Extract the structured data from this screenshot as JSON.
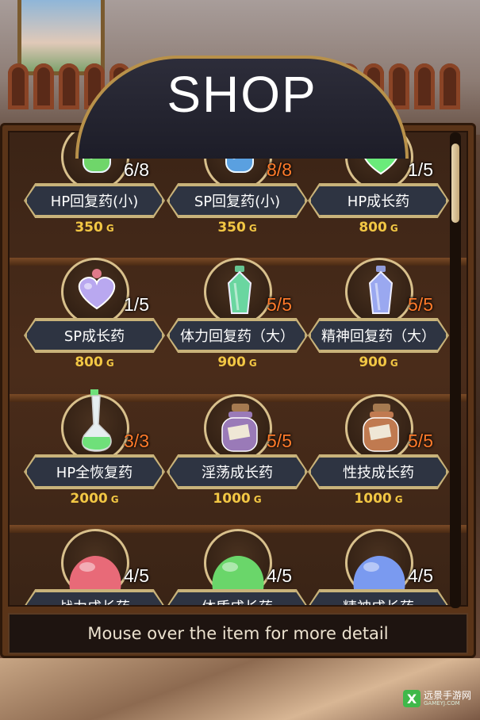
{
  "shop": {
    "title": "SHOP",
    "footer_text": "Mouse over the item for more detail",
    "currency": "G"
  },
  "items": [
    {
      "name": "HP回复药(小)",
      "count": "6/8",
      "price": "350",
      "color": "#6fd66a",
      "shape": "bottle",
      "full": false
    },
    {
      "name": "SP回复药(小)",
      "count": "8/8",
      "price": "350",
      "color": "#5aa0e0",
      "shape": "bottle",
      "full": true
    },
    {
      "name": "HP成长药",
      "count": "1/5",
      "price": "800",
      "color": "#6aeb7a",
      "shape": "heart",
      "full": false
    },
    {
      "name": "SP成长药",
      "count": "1/5",
      "price": "800",
      "color": "#b9a8f0",
      "shape": "heart",
      "full": false
    },
    {
      "name": "体力回复药（大）",
      "count": "5/5",
      "price": "900",
      "color": "#6ad6a0",
      "shape": "crystal",
      "full": true
    },
    {
      "name": "精神回复药（大）",
      "count": "5/5",
      "price": "900",
      "color": "#9aa8f0",
      "shape": "crystal",
      "full": true
    },
    {
      "name": "HP全恢复药",
      "count": "3/3",
      "price": "2000",
      "color": "#6fe07a",
      "shape": "flask",
      "full": true
    },
    {
      "name": "淫荡成长药",
      "count": "5/5",
      "price": "1000",
      "color": "#9a7ab8",
      "shape": "jar",
      "full": true
    },
    {
      "name": "性技成长药",
      "count": "5/5",
      "price": "1000",
      "color": "#c07a50",
      "shape": "jar",
      "full": true
    },
    {
      "name": "战力成长药",
      "count": "4/5",
      "price": "",
      "color": "#e86a78",
      "shape": "slime",
      "full": false
    },
    {
      "name": "体质成长药",
      "count": "4/5",
      "price": "",
      "color": "#6ad66a",
      "shape": "slime",
      "full": false
    },
    {
      "name": "精神成长药",
      "count": "4/5",
      "price": "",
      "color": "#7a9af0",
      "shape": "slime",
      "full": false
    }
  ],
  "watermark": {
    "mark": "X",
    "text": "远景手游网",
    "sub": "GAMEYJ.COM"
  }
}
